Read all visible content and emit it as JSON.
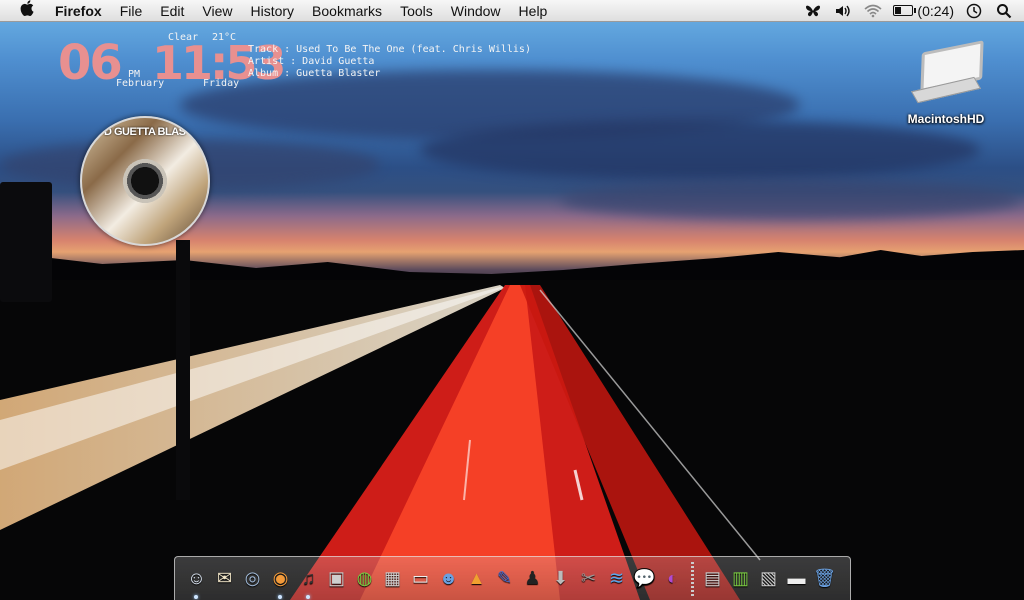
{
  "menubar": {
    "apple_glyph": "",
    "app_name": "Firefox",
    "items": [
      "File",
      "Edit",
      "View",
      "History",
      "Bookmarks",
      "Tools",
      "Window",
      "Help"
    ],
    "status": {
      "battery_text": "(0:24)",
      "battery_level": 0.35,
      "icons": [
        "butterfly-icon",
        "volume-icon",
        "wifi-icon",
        "battery-icon",
        "clock-icon",
        "spotlight-search-icon"
      ]
    }
  },
  "clock": {
    "day": "06",
    "time": "11:53",
    "ampm": "PM",
    "month": "February",
    "weekday": "Friday",
    "weather": "Clear",
    "temperature": "21°C"
  },
  "now_playing": {
    "track_line": "Track  : Used To Be The One (feat. Chris Willis)",
    "artist_line": "Artist : David Guetta",
    "album_line": "Album  : Guetta Blaster",
    "album_art_text": "D GUETTA BLAS"
  },
  "desktop": {
    "hd_label": "MacintoshHD"
  },
  "dock": {
    "left_items": [
      {
        "name": "finder-icon",
        "glyph": "☺",
        "running": true
      },
      {
        "name": "mail-icon",
        "glyph": "✉",
        "running": false
      },
      {
        "name": "safari-icon",
        "glyph": "◎",
        "running": false
      },
      {
        "name": "firefox-icon",
        "glyph": "◉",
        "running": true
      },
      {
        "name": "itunes-headphones-icon",
        "glyph": "♫",
        "running": true
      },
      {
        "name": "photo-booth-icon",
        "glyph": "▣",
        "running": false
      },
      {
        "name": "cd-icon",
        "glyph": "◍",
        "running": false
      },
      {
        "name": "preview-icon",
        "glyph": "▦",
        "running": false
      },
      {
        "name": "laptop-icon",
        "glyph": "▭",
        "running": false
      },
      {
        "name": "messenger-icon",
        "glyph": "☻",
        "running": false
      },
      {
        "name": "vlc-icon",
        "glyph": "▲",
        "running": false
      },
      {
        "name": "marker-icon",
        "glyph": "✎",
        "running": false
      },
      {
        "name": "user-icon",
        "glyph": "♟",
        "running": false
      },
      {
        "name": "installer-icon",
        "glyph": "⬇",
        "running": false
      },
      {
        "name": "utilities-icon",
        "glyph": "✂",
        "running": false
      },
      {
        "name": "wireless-icon",
        "glyph": "≋",
        "running": false
      },
      {
        "name": "chat-icon",
        "glyph": "💬",
        "running": false
      },
      {
        "name": "network-globe-icon",
        "glyph": "◐",
        "running": false
      }
    ],
    "right_items": [
      {
        "name": "folder-icon",
        "glyph": "▤"
      },
      {
        "name": "documents-icon",
        "glyph": "▥"
      },
      {
        "name": "downloads-icon",
        "glyph": "▧"
      },
      {
        "name": "drive-icon",
        "glyph": "▬"
      },
      {
        "name": "trash-icon",
        "glyph": "🗑"
      }
    ]
  },
  "colors": {
    "clock_digits": "#e89090",
    "menubar_bg": "#ececec",
    "dock_indicator": "#cfe6ff"
  }
}
